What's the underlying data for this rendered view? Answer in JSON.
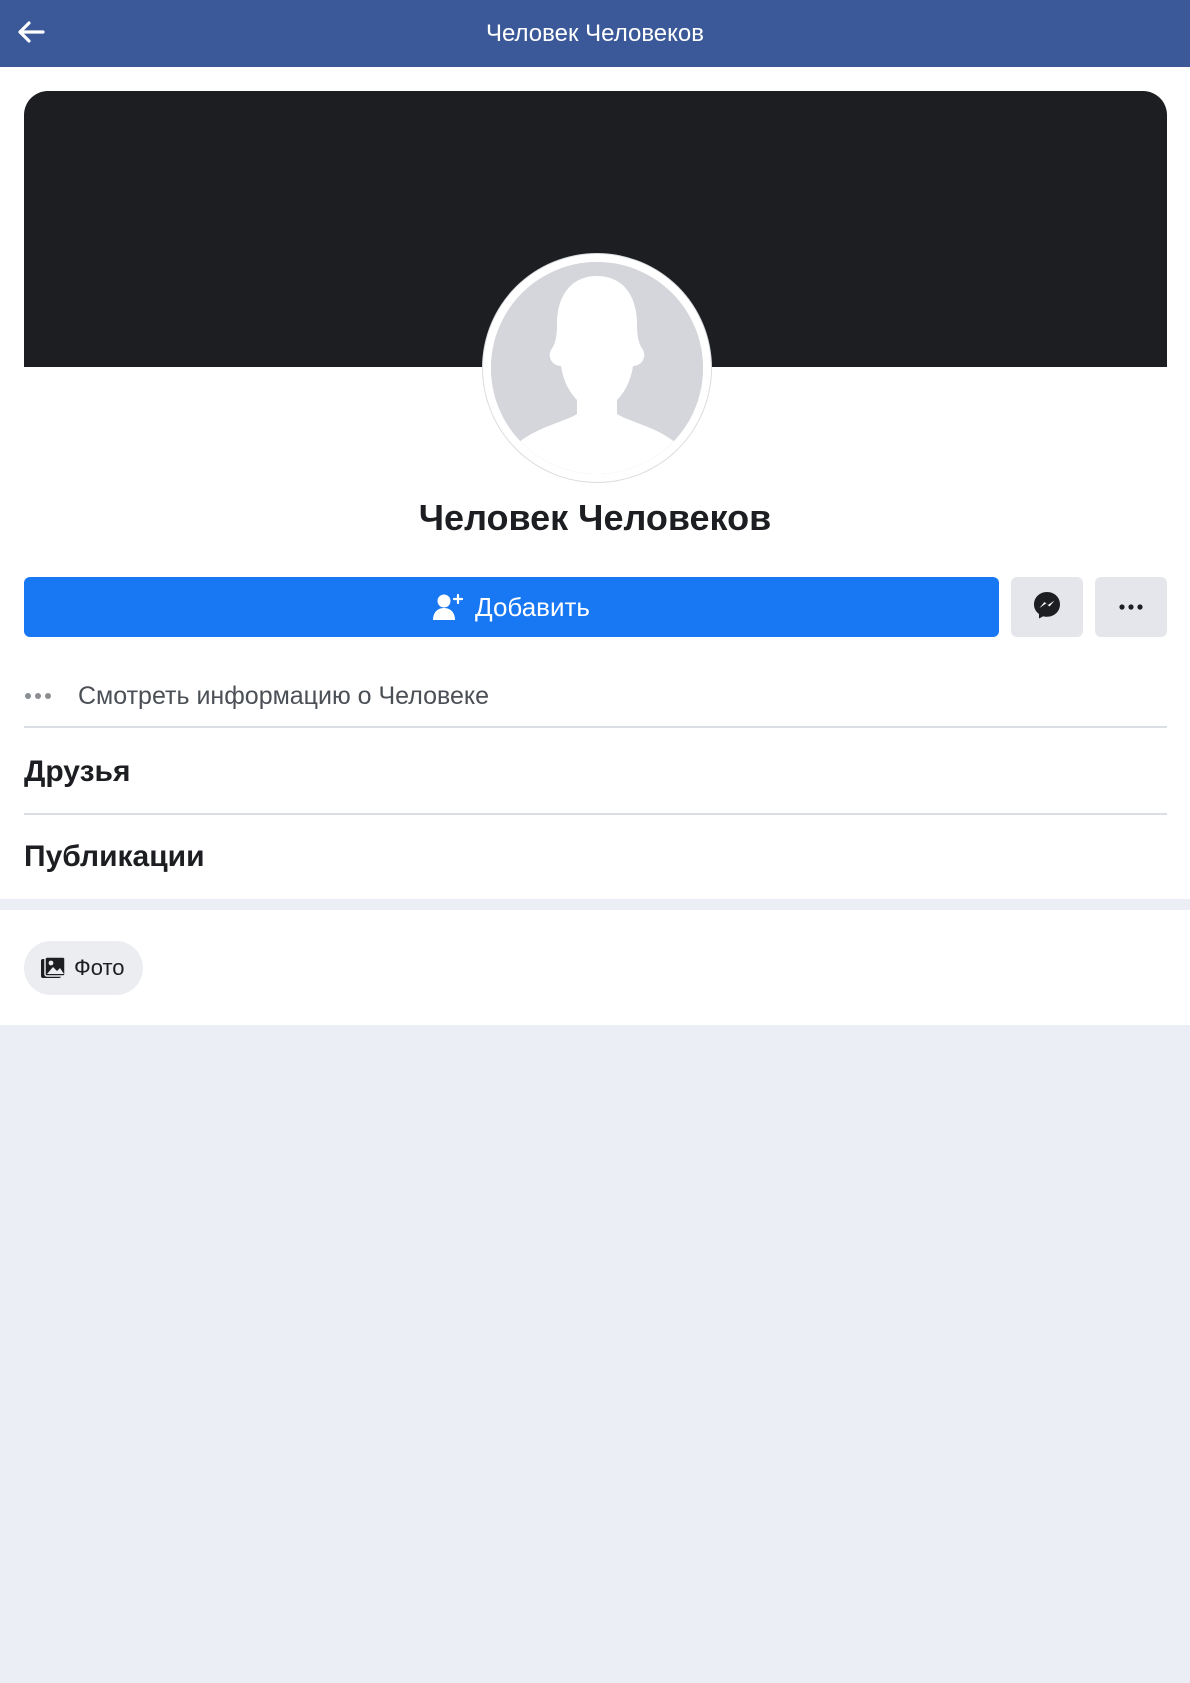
{
  "header": {
    "title": "Человек Человеков",
    "back_icon": "arrow-left-icon",
    "background_color": "#3b5998"
  },
  "profile": {
    "name": "Человек Человеков",
    "cover_color": "#1c1e21",
    "avatar": "default-avatar-silhouette"
  },
  "actions": {
    "add_friend_label": "Добавить",
    "add_friend_icon": "add-friend-icon",
    "add_friend_color": "#1877f2",
    "message_icon": "messenger-icon",
    "more_icon": "more-options-icon"
  },
  "info": {
    "label": "Смотреть информацию о Человеке",
    "icon": "dots-icon"
  },
  "sections": {
    "friends": "Друзья",
    "posts": "Публикации"
  },
  "filters": {
    "photos_label": "Фото",
    "photos_icon": "photos-icon"
  }
}
